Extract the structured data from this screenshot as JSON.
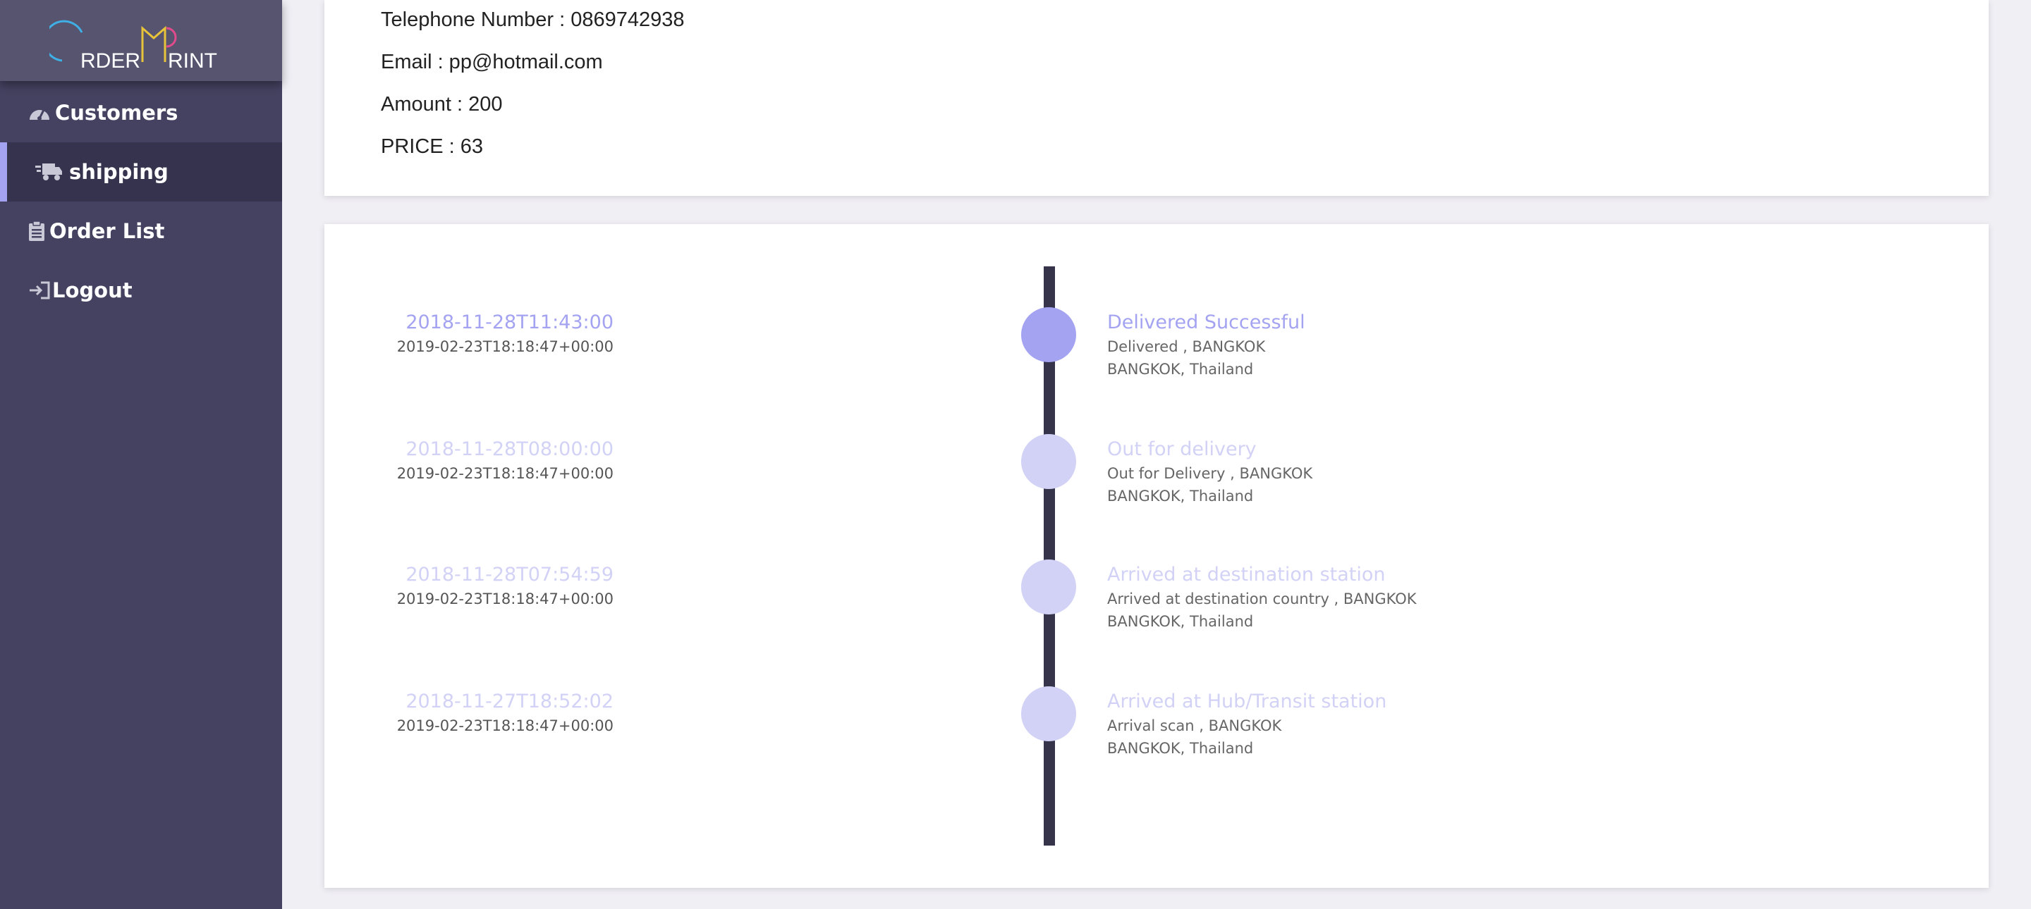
{
  "logo": {
    "text_left": "RDER",
    "text_right": "RINT"
  },
  "sidebar": {
    "items": [
      {
        "label": "Customers",
        "icon": "dashboard-icon"
      },
      {
        "label": "shipping",
        "icon": "truck-icon",
        "active": true
      },
      {
        "label": "Order List",
        "icon": "clipboard-icon"
      },
      {
        "label": "Logout",
        "icon": "logout-icon"
      }
    ]
  },
  "info": {
    "telephone": "Telephone Number : 0869742938",
    "email": "Email : pp@hotmail.com",
    "amount": "Amount : 200",
    "price": "PRICE : 63"
  },
  "timeline": [
    {
      "date": "2018-11-28T11:43:00",
      "updated": "2019-02-23T18:18:47+00:00",
      "status": "Delivered Successful",
      "detail": "Delivered , BANGKOK",
      "location": "BANGKOK, Thailand",
      "active": true
    },
    {
      "date": "2018-11-28T08:00:00",
      "updated": "2019-02-23T18:18:47+00:00",
      "status": "Out for delivery",
      "detail": "Out for Delivery , BANGKOK",
      "location": "BANGKOK, Thailand",
      "active": false
    },
    {
      "date": "2018-11-28T07:54:59",
      "updated": "2019-02-23T18:18:47+00:00",
      "status": "Arrived at destination station",
      "detail": "Arrived at destination country , BANGKOK",
      "location": "BANGKOK, Thailand",
      "active": false
    },
    {
      "date": "2018-11-27T18:52:02",
      "updated": "2019-02-23T18:18:47+00:00",
      "status": "Arrived at Hub/Transit station",
      "detail": "Arrival scan , BANGKOK",
      "location": "BANGKOK, Thailand",
      "active": false
    }
  ],
  "colors": {
    "accent": "#a4a3f2",
    "accent_light": "#d2d1f6",
    "sidebar": "#444260",
    "timeline_bar": "#36344a"
  }
}
